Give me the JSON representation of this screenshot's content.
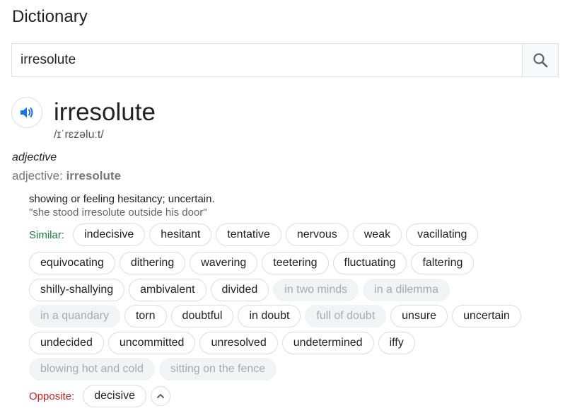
{
  "header": {
    "title": "Dictionary"
  },
  "search": {
    "value": "irresolute",
    "icon": "search-icon"
  },
  "entry": {
    "word": "irresolute",
    "phonetic": "/ɪˈrɛzəluːt/",
    "speaker_icon": "speaker-icon",
    "part_of_speech": "adjective",
    "pos_label": "adjective:",
    "pos_word": "irresolute",
    "definition": "showing or feeling hesitancy; uncertain.",
    "example": "\"she stood irresolute outside his door\""
  },
  "similar": {
    "label": "Similar:",
    "rows": [
      [
        "indecisive",
        "hesitant",
        "tentative",
        "nervous",
        "weak",
        "vacillating"
      ],
      [
        "equivocating",
        "dithering",
        "wavering",
        "teetering",
        "fluctuating",
        "faltering"
      ],
      [
        "shilly-shallying",
        "ambivalent",
        "divided",
        "in two minds",
        "in a dilemma"
      ],
      [
        "in a quandary",
        "torn",
        "doubtful",
        "in doubt",
        "full of doubt",
        "unsure",
        "uncertain"
      ],
      [
        "undecided",
        "uncommitted",
        "unresolved",
        "undetermined",
        "iffy"
      ],
      [
        "blowing hot and cold",
        "sitting on the fence"
      ]
    ],
    "dimmed": [
      "in two minds",
      "in a dilemma",
      "in a quandary",
      "full of doubt",
      "blowing hot and cold",
      "sitting on the fence"
    ]
  },
  "opposite": {
    "label": "Opposite:",
    "words": [
      "decisive"
    ],
    "collapse_icon": "chevron-up-icon"
  },
  "colors": {
    "similar_label": "#188038",
    "opposite_label": "#c5221f",
    "speaker": "#1a73e8"
  }
}
